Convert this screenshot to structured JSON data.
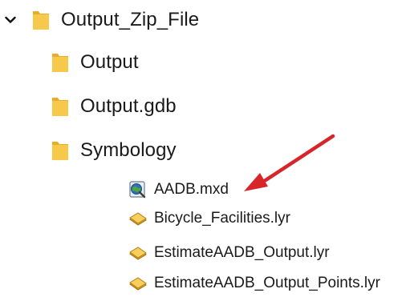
{
  "tree": {
    "root": {
      "label": "Output_Zip_File",
      "expanded": true,
      "icon": "folder-icon"
    },
    "folders": [
      {
        "label": "Output",
        "icon": "folder-icon"
      },
      {
        "label": "Output.gdb",
        "icon": "folder-icon"
      },
      {
        "label": "Symbology",
        "icon": "folder-icon",
        "expanded": true
      }
    ],
    "files": [
      {
        "label": "AADB.mxd",
        "icon": "arcmap-document-icon"
      },
      {
        "label": "Bicycle_Facilities.lyr",
        "icon": "layer-file-icon"
      },
      {
        "label": "EstimateAADB_Output.lyr",
        "icon": "layer-file-icon"
      },
      {
        "label": "EstimateAADB_Output_Points.lyr",
        "icon": "layer-file-icon"
      }
    ]
  },
  "annotation": {
    "arrow_color": "#d7262a",
    "points_to": "AADB.mxd"
  },
  "colors": {
    "folder": "#f6c94b",
    "folder_dark": "#e5ad2a",
    "text": "#1a1a1a"
  }
}
